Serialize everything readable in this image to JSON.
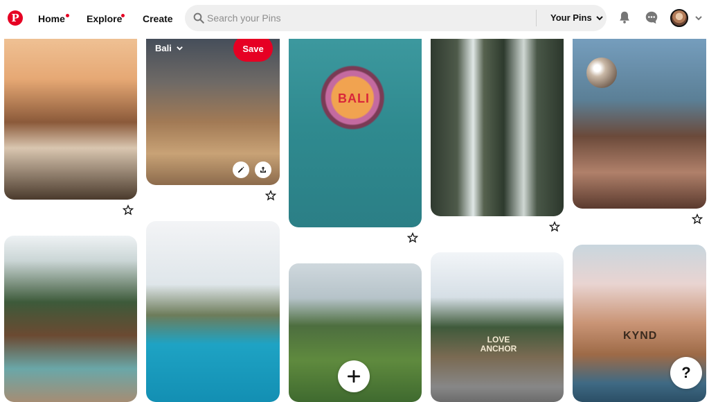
{
  "header": {
    "nav": [
      {
        "label": "Home",
        "has_dot": true
      },
      {
        "label": "Explore",
        "has_dot": true
      },
      {
        "label": "Create",
        "has_dot": false
      }
    ],
    "search": {
      "placeholder": "Search your Pins",
      "value": "",
      "scope": "Your Pins"
    },
    "icons": [
      "pinterest-logo-icon",
      "search-icon",
      "chevron-down-icon",
      "bell-icon",
      "chat-icon",
      "avatar",
      "chevron-down-icon"
    ]
  },
  "hovered_pin": {
    "board": "Bali",
    "save_label": "Save"
  },
  "pins": [
    {
      "image": "beach-club-palms-umbrellas"
    },
    {
      "image": "bali-hammock-restaurant-sunset"
    },
    {
      "image": "smoothie-bowl-bali-letters"
    },
    {
      "image": "jungle-waterfalls"
    },
    {
      "image": "disco-ball-beach-party"
    },
    {
      "image": "thatched-roof-villas-pool"
    },
    {
      "image": "watermelon-drink-pool-bar"
    },
    {
      "image": "rice-terraces"
    },
    {
      "image": "love-anchor-sign-street"
    },
    {
      "image": "coconut-drink-kynd"
    }
  ],
  "image_text": {
    "bowl": "BALI",
    "sign": "LOVE ANCHOR",
    "coconut": "KYND"
  },
  "help_button": {
    "label": "?"
  },
  "colors": {
    "brand": "#e60023",
    "search_bg": "#efefef",
    "text": "#111111"
  }
}
